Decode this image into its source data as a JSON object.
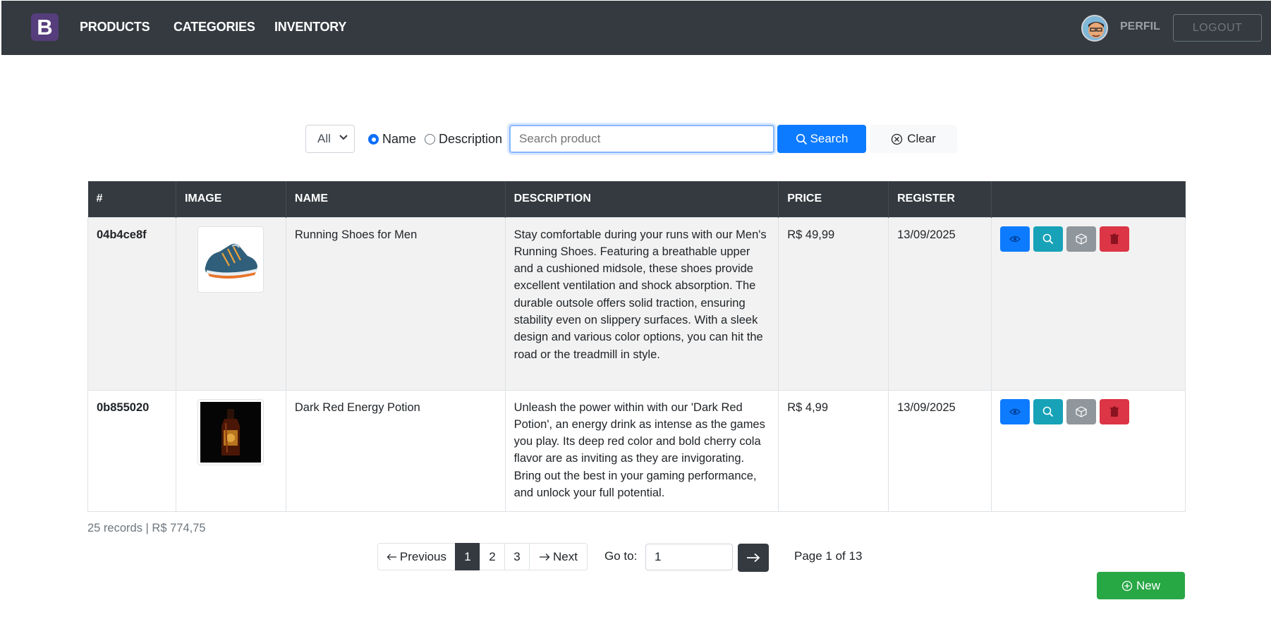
{
  "navbar": {
    "brand": "B",
    "links": [
      "PRODUCTS",
      "CATEGORIES",
      "INVENTORY"
    ],
    "profile_label": "PERFIL",
    "logout_label": "LOGOUT"
  },
  "search": {
    "filter_selected": "All",
    "radio_name": "Name",
    "radio_description": "Description",
    "selected_radio": "Name",
    "placeholder": "Search product",
    "value": "",
    "search_label": "Search",
    "clear_label": "Clear"
  },
  "table": {
    "headers": [
      "#",
      "IMAGE",
      "NAME",
      "DESCRIPTION",
      "PRICE",
      "REGISTER",
      ""
    ],
    "rows": [
      {
        "id": "04b4ce8f",
        "image": "running-shoe",
        "name": "Running Shoes for Men",
        "description": "Stay comfortable during your runs with our Men's Running Shoes. Featuring a breathable upper and a cushioned midsole, these shoes provide excellent ventilation and shock absorption. The durable outsole offers solid traction, ensuring stability even on slippery surfaces. With a sleek design and various color options, you can hit the road or the treadmill in style.",
        "price": "R$ 49,99",
        "register": "13/09/2025"
      },
      {
        "id": "0b855020",
        "image": "energy-potion-bottle",
        "name": "Dark Red Energy Potion",
        "description": "Unleash the power within with our 'Dark Red Potion', an energy drink as intense as the games you play. Its deep red color and bold cherry cola flavor are as inviting as they are invigorating. Bring out the best in your gaming performance, and unlock your full potential.",
        "price": "R$ 4,99",
        "register": "13/09/2025"
      }
    ]
  },
  "summary": "25 records | R$ 774,75",
  "pagination": {
    "previous_label": "Previous",
    "next_label": "Next",
    "pages": [
      "1",
      "2",
      "3"
    ],
    "current_page": "1",
    "goto_label": "Go to:",
    "goto_value": "1",
    "page_info": "Page 1 of 13"
  },
  "new_label": "New",
  "colors": {
    "navbar": "#343a40",
    "brand": "#563d7c",
    "primary": "#0d7bff",
    "info": "#17a2b8",
    "secondary": "#8f969c",
    "danger": "#dc3545",
    "success": "#28a745"
  }
}
